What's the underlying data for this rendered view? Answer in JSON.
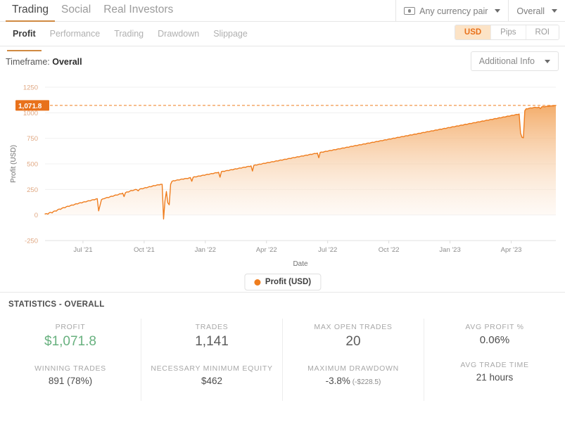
{
  "topnav": {
    "items": [
      {
        "label": "Trading",
        "active": true
      },
      {
        "label": "Social",
        "active": false
      },
      {
        "label": "Real Investors",
        "active": false
      }
    ],
    "currency_filter": "Any currency pair",
    "timeframe_filter": "Overall",
    "currency_icon": "banknote-icon",
    "caret_icon": "chevron-down-icon"
  },
  "subnav": {
    "items": [
      {
        "label": "Profit",
        "active": true
      },
      {
        "label": "Performance",
        "active": false
      },
      {
        "label": "Trading",
        "active": false
      },
      {
        "label": "Drawdown",
        "active": false
      },
      {
        "label": "Slippage",
        "active": false
      }
    ],
    "unit_toggle": [
      {
        "label": "USD",
        "active": true
      },
      {
        "label": "Pips",
        "active": false
      },
      {
        "label": "ROI",
        "active": false
      }
    ]
  },
  "timeframe": {
    "prefix": "Timeframe:",
    "value": "Overall",
    "additional_info": "Additional Info"
  },
  "colors": {
    "accent_orange": "#ef7d1e",
    "badge_orange": "#e8711b",
    "toggle_bg": "#fce3c6",
    "underline": "#d08a42",
    "profit_green": "#68b17f",
    "area_top": "#f3a964",
    "area_bottom": "#fdf3ea"
  },
  "chart_data": {
    "type": "area",
    "title": "",
    "xlabel": "Date",
    "ylabel": "Profit (USD)",
    "ylim": [
      -250,
      1250
    ],
    "yticks": [
      -250,
      0,
      250,
      500,
      750,
      1000,
      1250
    ],
    "ytick_labels": [
      "-250",
      "0",
      "250",
      "500",
      "750",
      "1000",
      "1250"
    ],
    "xticks": [
      "Jul '21",
      "Oct '21",
      "Jan '22",
      "Apr '22",
      "Jul '22",
      "Oct '22",
      "Jan '23",
      "Apr '23"
    ],
    "grid": true,
    "legend": [
      {
        "name": "Profit (USD)",
        "color": "#ef7d1e"
      }
    ],
    "legend_position": "bottom-center",
    "marker_line": {
      "value": 1071.8,
      "label": "1,071.8",
      "style": "dashed",
      "color": "#ef7d1e"
    },
    "series": [
      {
        "name": "Profit (USD)",
        "color": "#ef7d1e",
        "fill": true,
        "values": [
          10,
          14,
          8,
          22,
          26,
          20,
          35,
          40,
          38,
          52,
          58,
          55,
          66,
          72,
          70,
          80,
          86,
          84,
          92,
          98,
          96,
          104,
          110,
          108,
          116,
          120,
          118,
          126,
          130,
          128,
          136,
          140,
          138,
          146,
          150,
          148,
          156,
          160,
          40,
          96,
          150,
          158,
          160,
          166,
          172,
          170,
          178,
          184,
          182,
          190,
          196,
          194,
          200,
          208,
          206,
          214,
          180,
          218,
          226,
          224,
          232,
          240,
          238,
          244,
          250,
          248,
          236,
          252,
          258,
          256,
          262,
          268,
          266,
          272,
          278,
          276,
          282,
          288,
          286,
          292,
          296,
          294,
          300,
          300,
          -40,
          140,
          230,
          120,
          100,
          300,
          330,
          336,
          334,
          340,
          344,
          342,
          348,
          352,
          350,
          356,
          358,
          356,
          362,
          366,
          330,
          370,
          374,
          372,
          378,
          382,
          380,
          386,
          390,
          388,
          394,
          398,
          396,
          402,
          406,
          404,
          410,
          414,
          412,
          418,
          370,
          424,
          428,
          426,
          432,
          436,
          434,
          440,
          444,
          442,
          448,
          452,
          450,
          456,
          460,
          458,
          464,
          468,
          466,
          472,
          476,
          474,
          480,
          430,
          486,
          490,
          488,
          494,
          498,
          496,
          502,
          506,
          504,
          510,
          514,
          512,
          518,
          522,
          520,
          526,
          530,
          528,
          534,
          538,
          536,
          542,
          546,
          544,
          550,
          554,
          552,
          558,
          562,
          560,
          566,
          570,
          568,
          574,
          578,
          576,
          582,
          586,
          584,
          590,
          594,
          592,
          598,
          602,
          600,
          606,
          560,
          612,
          616,
          614,
          620,
          624,
          622,
          628,
          632,
          630,
          636,
          640,
          638,
          644,
          648,
          646,
          652,
          656,
          654,
          660,
          664,
          662,
          668,
          672,
          670,
          676,
          680,
          678,
          684,
          688,
          686,
          692,
          696,
          694,
          700,
          704,
          702,
          708,
          712,
          710,
          716,
          720,
          718,
          724,
          728,
          726,
          732,
          736,
          734,
          740,
          744,
          742,
          748,
          752,
          750,
          756,
          760,
          758,
          764,
          768,
          766,
          772,
          776,
          774,
          780,
          784,
          782,
          788,
          792,
          790,
          796,
          800,
          798,
          804,
          808,
          806,
          812,
          816,
          814,
          820,
          824,
          822,
          828,
          832,
          830,
          836,
          840,
          838,
          844,
          848,
          846,
          852,
          856,
          854,
          860,
          864,
          862,
          868,
          872,
          870,
          876,
          880,
          878,
          884,
          888,
          886,
          892,
          896,
          894,
          900,
          904,
          902,
          908,
          912,
          910,
          916,
          920,
          918,
          924,
          928,
          926,
          932,
          936,
          934,
          940,
          944,
          942,
          948,
          952,
          950,
          956,
          960,
          958,
          964,
          968,
          966,
          972,
          976,
          974,
          980,
          984,
          982,
          988,
          800,
          760,
          755,
          1020,
          1040,
          1038,
          1044,
          1048,
          1046,
          1050,
          1054,
          1052,
          1050,
          1056,
          1040,
          1058,
          1060,
          1058,
          1062,
          1064,
          1062,
          1066,
          1068,
          1066,
          1070,
          1071.8
        ]
      }
    ]
  },
  "statistics": {
    "title": "STATISTICS - OVERALL",
    "cells": [
      {
        "label": "PROFIT",
        "value": "$1,071.8",
        "accent": "green"
      },
      {
        "label": "TRADES",
        "value": "1,141",
        "accent": ""
      },
      {
        "label": "MAX OPEN TRADES",
        "value": "20",
        "accent": ""
      },
      {
        "label": "AVG PROFIT %",
        "value": "0.06%",
        "accent": ""
      }
    ],
    "cells2": [
      {
        "label": "WINNING TRADES",
        "value": "891 (78%)",
        "sub": ""
      },
      {
        "label": "NECESSARY MINIMUM EQUITY",
        "value": "$462",
        "sub": ""
      },
      {
        "label": "MAXIMUM DRAWDOWN",
        "value": "-3.8%",
        "sub": " (-$228.5)"
      },
      {
        "label": "AVG TRADE TIME",
        "value": "21 hours",
        "sub": ""
      }
    ]
  }
}
